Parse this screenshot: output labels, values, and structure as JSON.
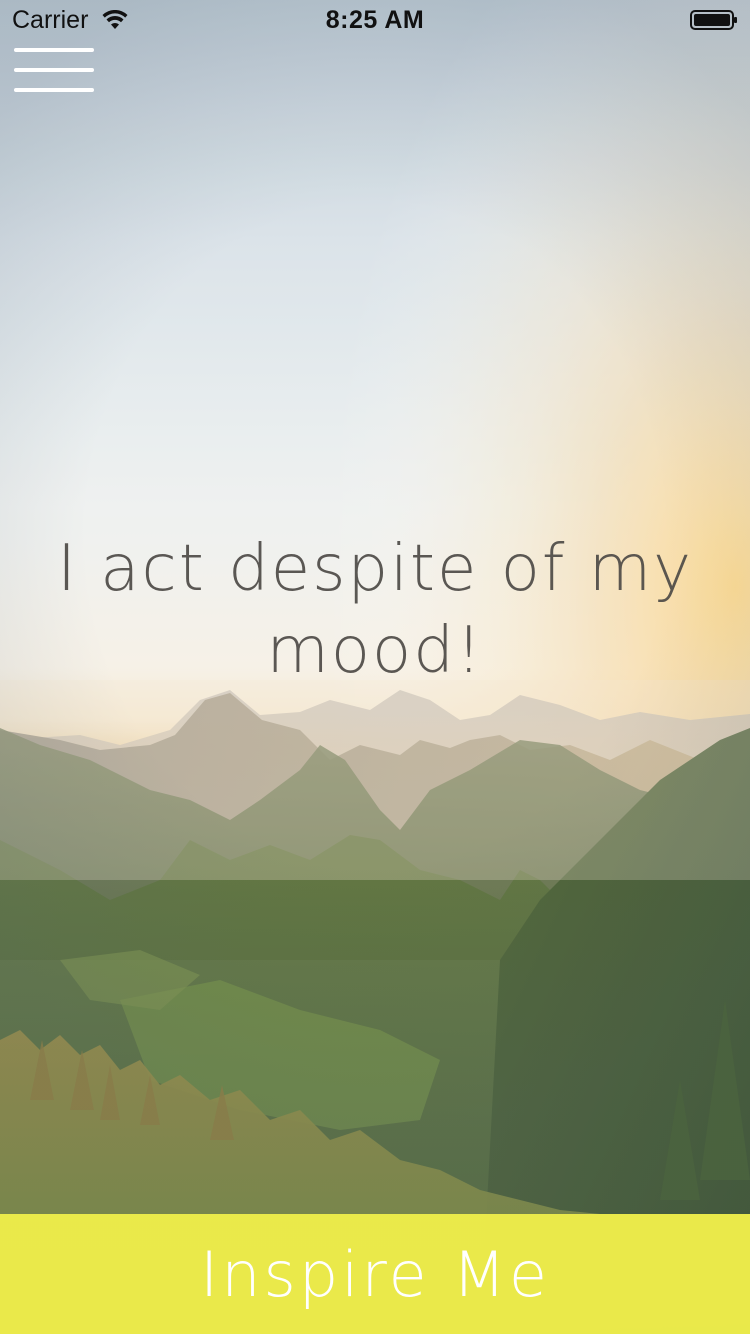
{
  "status_bar": {
    "carrier": "Carrier",
    "time": "8:25 AM",
    "wifi_icon": "wifi-icon",
    "battery_icon": "battery-icon"
  },
  "menu": {
    "icon": "hamburger-menu-icon"
  },
  "quote": {
    "text": "I act despite of my mood!"
  },
  "action": {
    "label": "Inspire Me",
    "color": "#F3F14A"
  },
  "colors": {
    "quote_text": "#4E4B47",
    "button_text": "#FFFFFF"
  }
}
